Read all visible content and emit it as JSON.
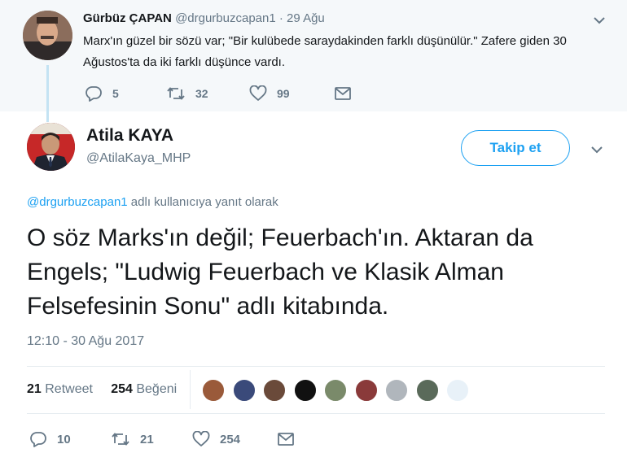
{
  "parent_tweet": {
    "name": "Gürbüz ÇAPAN",
    "handle": "@drgurbuzcapan1",
    "separator": "·",
    "date": "29 Ağu",
    "text": "Marx'ın güzel bir sözü var; \"Bir kulübede saraydakinden farklı düşünülür.\" Zafere giden 30 Ağustos'ta da iki farklı düşünce vardı.",
    "replies": "5",
    "retweets": "32",
    "likes": "99"
  },
  "main_tweet": {
    "name": "Atila KAYA",
    "handle": "@AtilaKaya_MHP",
    "follow_label": "Takip et",
    "reply_to_handle": "@drgurbuzcapan1",
    "reply_to_suffix": " adlı kullanıcıya yanıt olarak",
    "text": "O söz Marks'ın değil; Feuerbach'ın. Aktaran da Engels; \"Ludwig Feuerbach ve Klasik Alman Felsefesinin Sonu\" adlı kitabında.",
    "timestamp": "12:10 - 30 Ağu 2017",
    "retweet_count": "21",
    "retweet_label": "Retweet",
    "like_count": "254",
    "like_label": "Beğeni",
    "replies": "10",
    "retweets": "21",
    "likes": "254"
  },
  "likers": [
    {
      "color": "#9a5a3a"
    },
    {
      "color": "#3a4a7a"
    },
    {
      "color": "#6a4a3a"
    },
    {
      "color": "#111111"
    },
    {
      "color": "#7a8a6a"
    },
    {
      "color": "#8a3a3a"
    },
    {
      "color": "#b0b6bc"
    },
    {
      "color": "#5a6a5a"
    },
    {
      "color": "#e8f1f8"
    }
  ],
  "colors": {
    "accent": "#1da1f2",
    "muted": "#657786",
    "parent_bg": "#f5f8fa",
    "thread_line": "#c4e3f3"
  }
}
